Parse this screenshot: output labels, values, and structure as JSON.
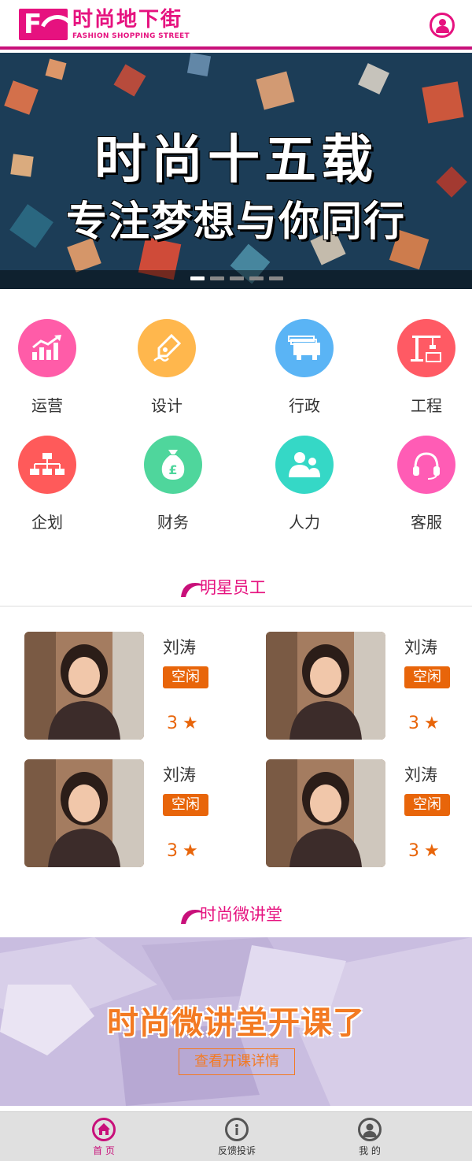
{
  "header": {
    "logo_cn": "时尚地下街",
    "logo_en": "FASHION SHOPPING STREET",
    "logo_mark": "F",
    "user_icon": "user-circle-icon",
    "brand_color": "#e6127f"
  },
  "banner": {
    "title_line1": "时尚十五载",
    "title_line2": "专注梦想与你同行",
    "slide_count": 5,
    "active_slide": 1
  },
  "categories": [
    {
      "label": "运营",
      "icon": "chart-up-icon",
      "color": "#ff5ca8"
    },
    {
      "label": "设计",
      "icon": "pen-nib-icon",
      "color": "#ffb74d"
    },
    {
      "label": "行政",
      "icon": "files-icon",
      "color": "#5ab4f5"
    },
    {
      "label": "工程",
      "icon": "crane-icon",
      "color": "#ff5a64"
    },
    {
      "label": "企划",
      "icon": "org-chart-icon",
      "color": "#ff5a5a"
    },
    {
      "label": "财务",
      "icon": "money-bag-icon",
      "color": "#4fd69c"
    },
    {
      "label": "人力",
      "icon": "people-icon",
      "color": "#35d8c6"
    },
    {
      "label": "客服",
      "icon": "headset-icon",
      "color": "#ff5cb5"
    }
  ],
  "star_section": {
    "title": "明星员工"
  },
  "staff": [
    {
      "name": "刘涛",
      "status": "空闲",
      "rating": "3",
      "star": "★"
    },
    {
      "name": "刘涛",
      "status": "空闲",
      "rating": "3",
      "star": "★"
    },
    {
      "name": "刘涛",
      "status": "空闲",
      "rating": "3",
      "star": "★"
    },
    {
      "name": "刘涛",
      "status": "空闲",
      "rating": "3",
      "star": "★"
    }
  ],
  "lecture_section": {
    "title": "时尚微讲堂",
    "banner_title": "时尚微讲堂开课了",
    "button_label": "查看开课详情"
  },
  "tabbar": {
    "items": [
      {
        "label": "首 页",
        "icon": "home-icon",
        "active": true
      },
      {
        "label": "反馈投诉",
        "icon": "info-icon",
        "active": false
      },
      {
        "label": "我 的",
        "icon": "user-icon",
        "active": false
      }
    ]
  }
}
